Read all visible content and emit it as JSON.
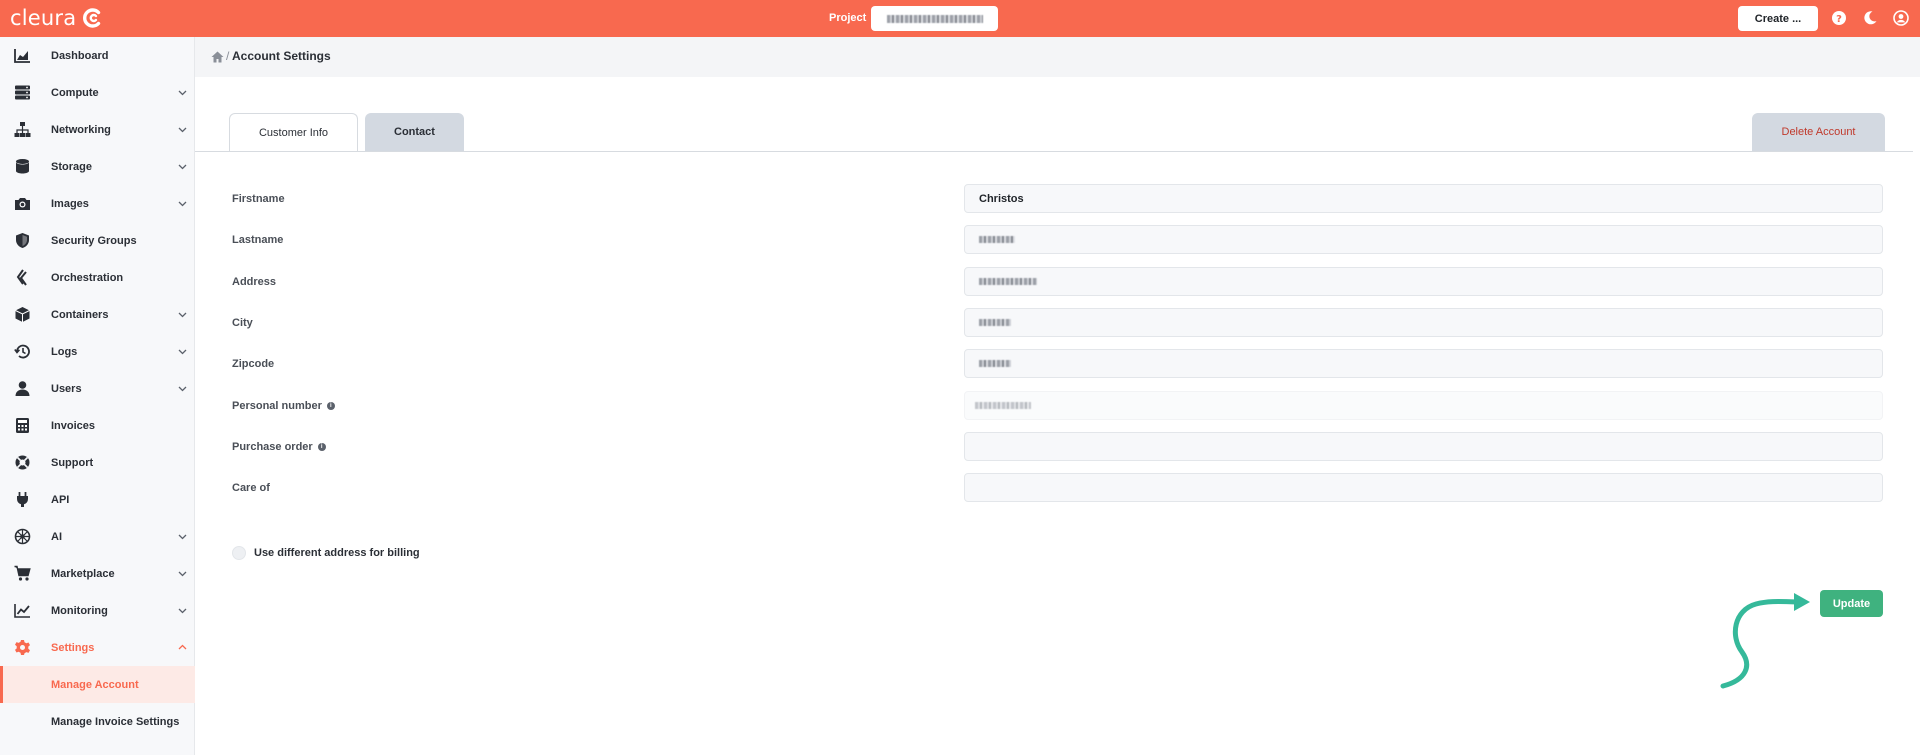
{
  "app": {
    "brand": "cleura",
    "colors": {
      "accent": "#f8694f",
      "success": "#3fb27f",
      "danger": "#c0392b"
    }
  },
  "topbar": {
    "project_label": "Project",
    "create_label": "Create ...",
    "icons": [
      "help-icon",
      "moon-icon",
      "user-icon"
    ]
  },
  "sidebar": {
    "items": [
      {
        "label": "Dashboard",
        "icon": "chart-icon",
        "chevron": false
      },
      {
        "label": "Compute",
        "icon": "server-icon",
        "chevron": true
      },
      {
        "label": "Networking",
        "icon": "network-icon",
        "chevron": true
      },
      {
        "label": "Storage",
        "icon": "database-icon",
        "chevron": true
      },
      {
        "label": "Images",
        "icon": "camera-icon",
        "chevron": true
      },
      {
        "label": "Security Groups",
        "icon": "shield-icon",
        "chevron": false
      },
      {
        "label": "Orchestration",
        "icon": "layers-icon",
        "chevron": false
      },
      {
        "label": "Containers",
        "icon": "box-icon",
        "chevron": true
      },
      {
        "label": "Logs",
        "icon": "history-icon",
        "chevron": true
      },
      {
        "label": "Users",
        "icon": "user-icon",
        "chevron": true
      },
      {
        "label": "Invoices",
        "icon": "calculator-icon",
        "chevron": false
      },
      {
        "label": "Support",
        "icon": "lifebuoy-icon",
        "chevron": false
      },
      {
        "label": "API",
        "icon": "plug-icon",
        "chevron": false
      },
      {
        "label": "AI",
        "icon": "ai-icon",
        "chevron": true
      },
      {
        "label": "Marketplace",
        "icon": "cart-icon",
        "chevron": true
      },
      {
        "label": "Monitoring",
        "icon": "line-chart-icon",
        "chevron": true
      },
      {
        "label": "Settings",
        "icon": "gear-icon",
        "chevron": true,
        "expanded": true
      }
    ],
    "settings_sub": [
      {
        "label": "Manage Account",
        "selected": true
      },
      {
        "label": "Manage Invoice Settings",
        "selected": false
      }
    ]
  },
  "breadcrumb": {
    "sep": "/",
    "title": "Account Settings"
  },
  "tabs": {
    "customer_info": "Customer Info",
    "contact": "Contact",
    "delete_account": "Delete Account"
  },
  "form": {
    "fields": [
      {
        "label": "Firstname",
        "value": "Christos",
        "redacted": false,
        "info": false
      },
      {
        "label": "Lastname",
        "value": "",
        "redacted": true,
        "info": false
      },
      {
        "label": "Address",
        "value": "",
        "redacted": true,
        "info": false
      },
      {
        "label": "City",
        "value": "",
        "redacted": true,
        "info": false
      },
      {
        "label": "Zipcode",
        "value": "",
        "redacted": true,
        "info": false
      },
      {
        "label": "Personal number",
        "value": "",
        "redacted": true,
        "info": true,
        "readonly": true
      },
      {
        "label": "Purchase order",
        "value": "",
        "redacted": false,
        "info": true
      },
      {
        "label": "Care of",
        "value": "",
        "redacted": false,
        "info": false
      }
    ],
    "billing_option": "Use different address for billing",
    "update_label": "Update"
  }
}
